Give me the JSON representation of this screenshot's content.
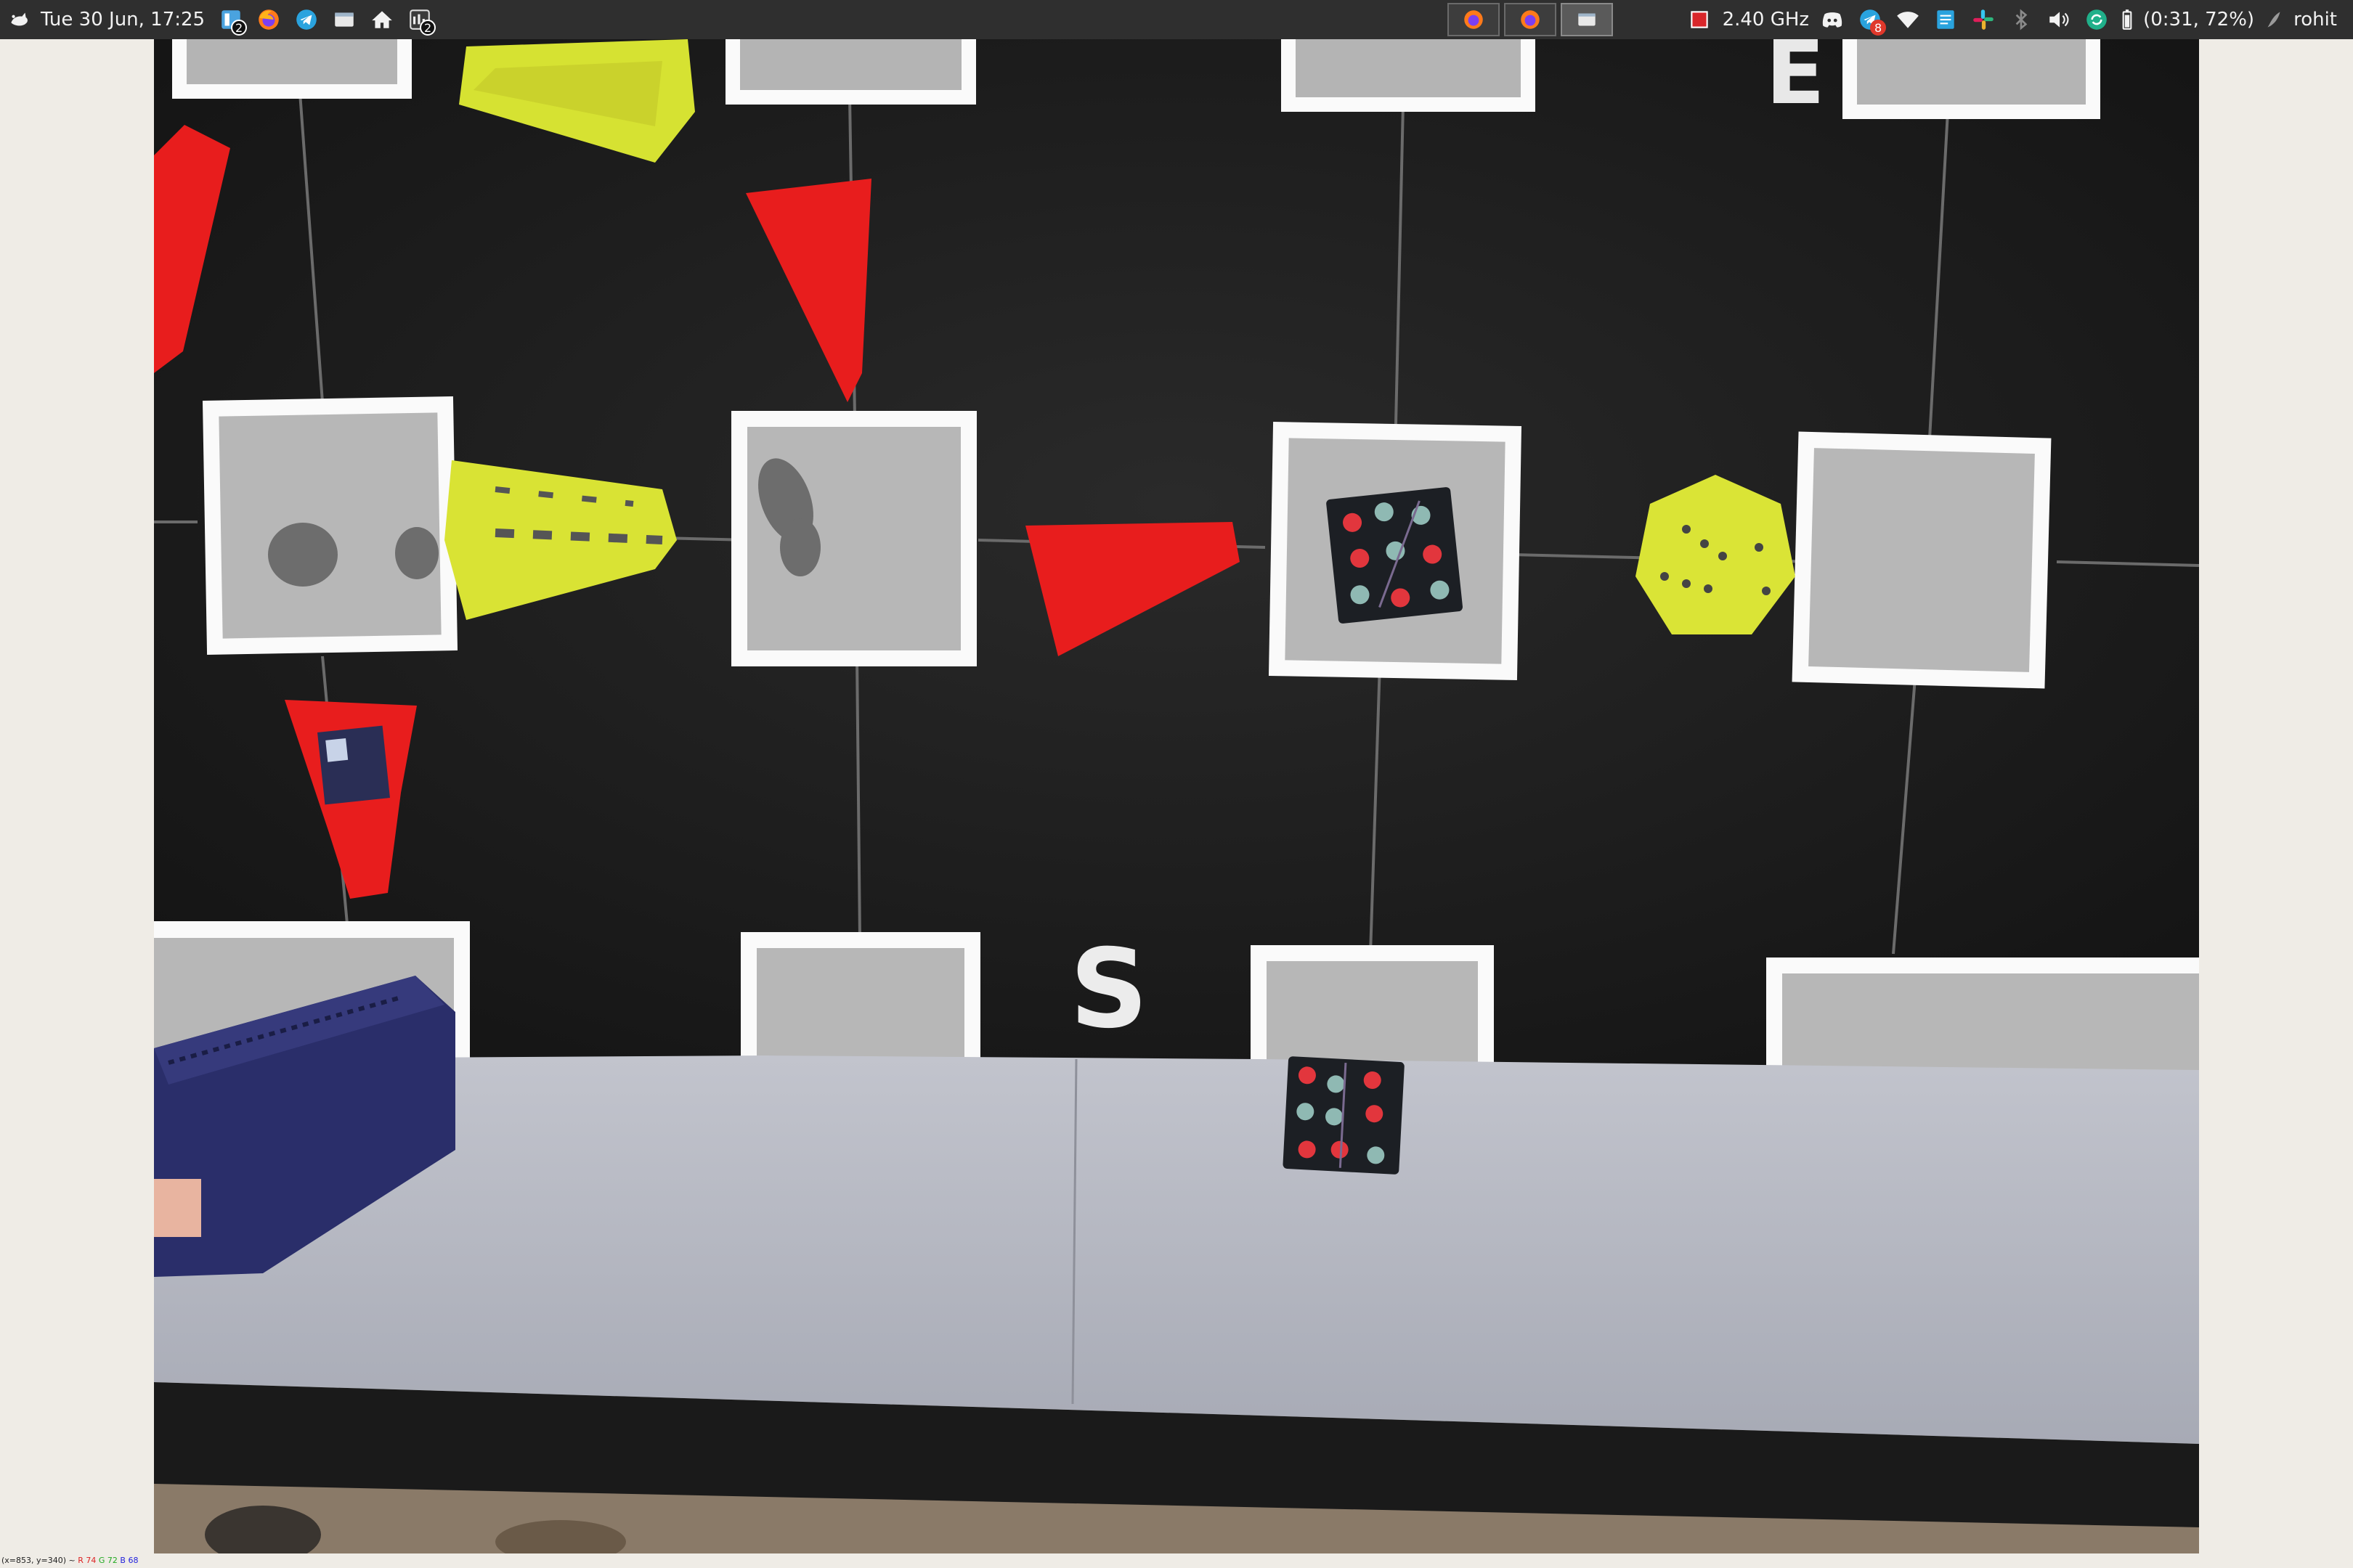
{
  "panel": {
    "datetime": "Tue 30 Jun, 17:25",
    "workspace_badge": "2",
    "multiload_badge": "2",
    "cpu_freq": "2.40 GHz",
    "telegram_badge": "8",
    "battery": "(0:31, 72%)",
    "user": "rohit",
    "launchers": [
      "xfce-menu-icon",
      "workspace-icon",
      "firefox-icon",
      "telegram-icon",
      "window-icon",
      "home-icon",
      "multiload-icon"
    ],
    "tasks": [
      "firefox-icon",
      "firefox-icon",
      "window-icon"
    ]
  },
  "board": {
    "label_top": "E",
    "label_bottom": "S"
  },
  "status": {
    "coords": "(x=853, y=340) ~",
    "r": "R 74",
    "g": "G 72",
    "b": "B 68"
  },
  "colors": {
    "panel_bg": "#2f2f2f",
    "board_black": "#1e1e1e",
    "tile_grey": "#b9b9b9",
    "red_piece": "#e81d1d",
    "yellow_piece": "#d9e334",
    "navy_box": "#2a2e6a",
    "surface_grey": "#b4b6c0"
  }
}
